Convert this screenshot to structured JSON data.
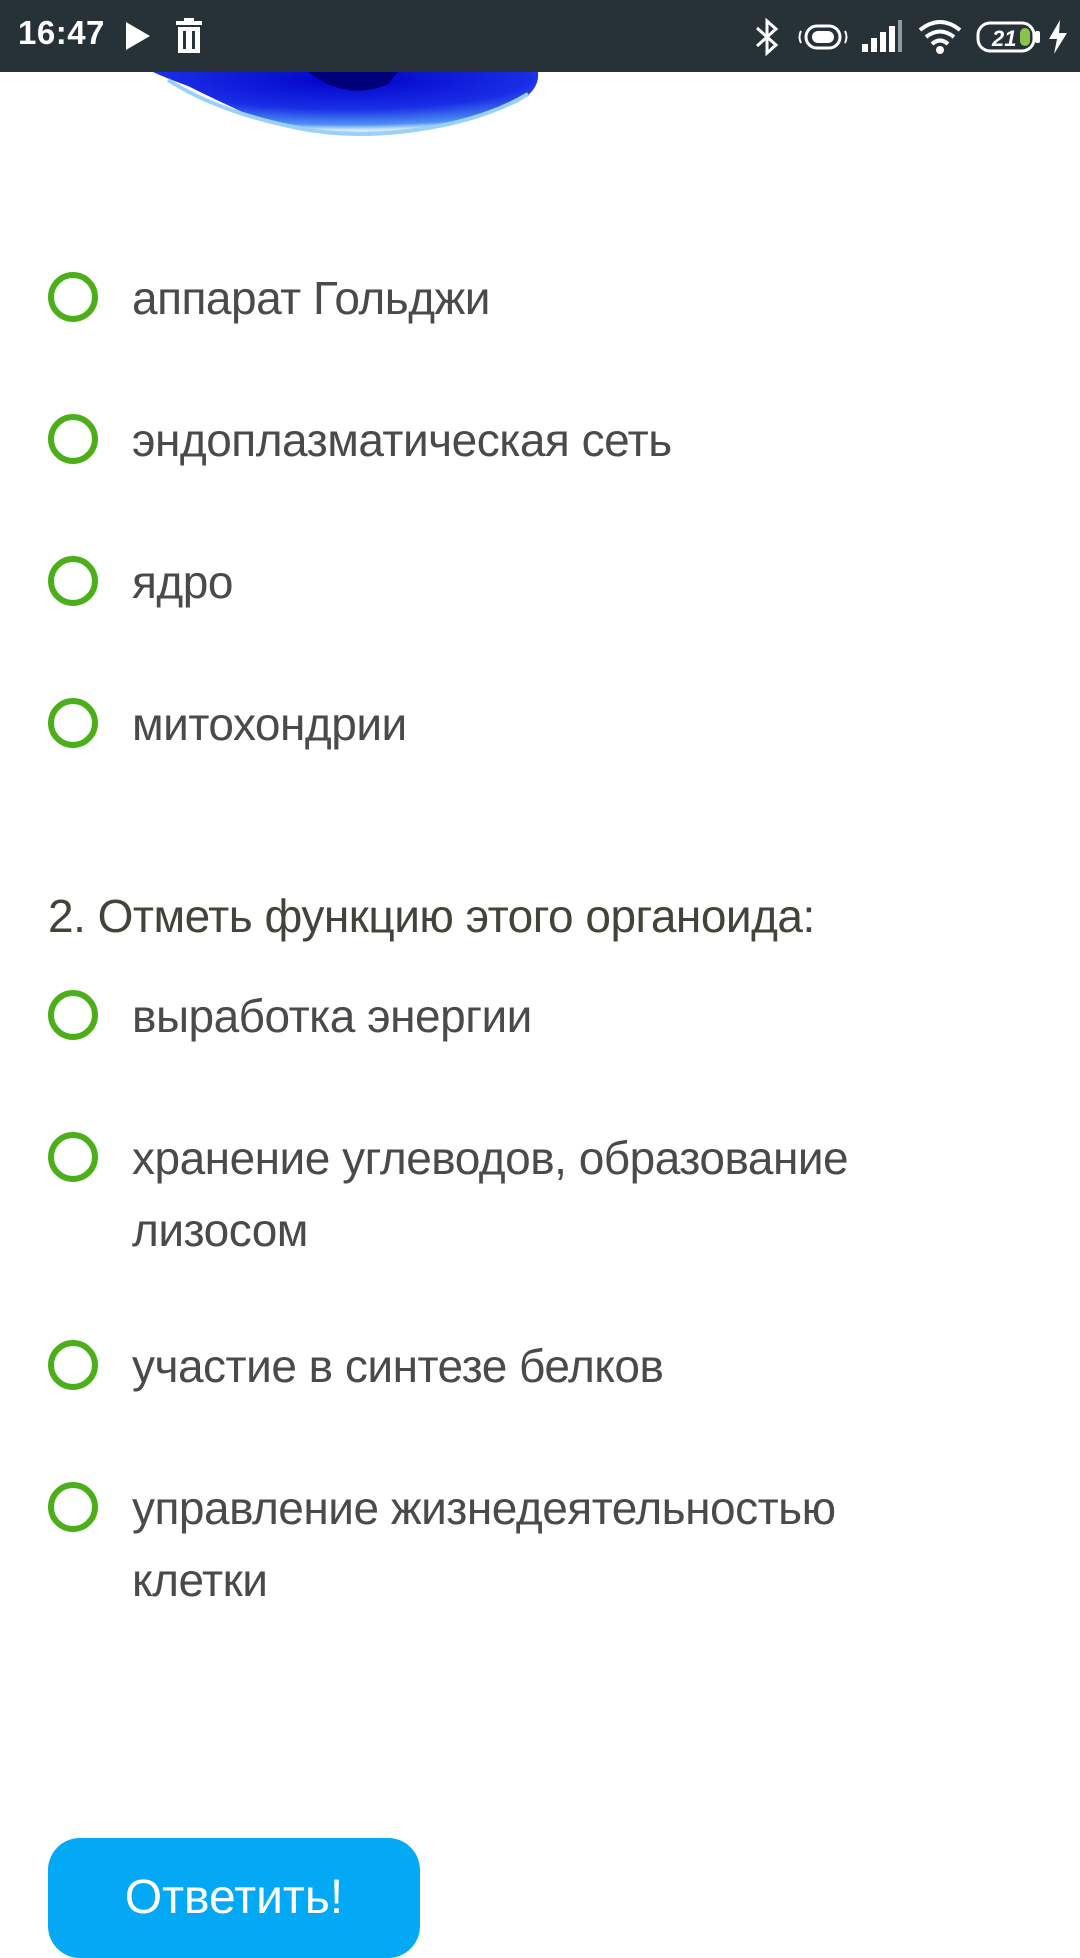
{
  "status_bar": {
    "time": "16:47",
    "battery_level": "21"
  },
  "question1": {
    "options": [
      {
        "label": "аппарат Гольджи"
      },
      {
        "label": "эндоплазматическая сеть"
      },
      {
        "label": "ядро"
      },
      {
        "label": "митохондрии"
      }
    ]
  },
  "question2": {
    "title": "2. Отметь функцию этого органоида:",
    "options": [
      {
        "label": "выработка энергии"
      },
      {
        "label": "хранение углеводов, образование лизосом"
      },
      {
        "label": "участие в синтезе белков"
      },
      {
        "label": "управление жизнедеятельностью клетки"
      }
    ]
  },
  "submit": {
    "label": "Ответить!"
  },
  "colors": {
    "status_bar_bg": "#263238",
    "radio_border": "#4caf1a",
    "button_bg": "#03a9f4",
    "text": "#4a4a4a"
  }
}
